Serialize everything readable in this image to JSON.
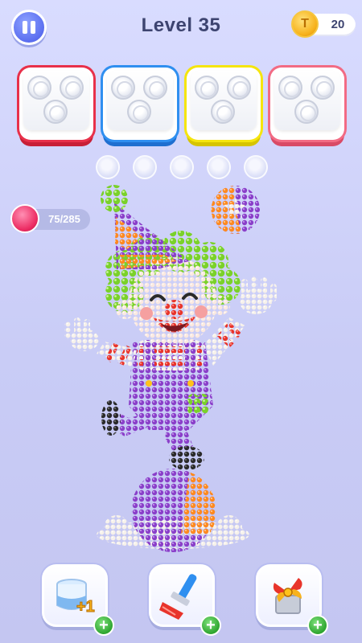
{
  "header": {
    "level_label": "Level 35",
    "coins": "20"
  },
  "progress": {
    "label": "75/285",
    "collected": 75,
    "total": 285
  },
  "boxes": [
    {
      "color": "#e8304a",
      "jars": 3
    },
    {
      "color": "#2f8ff0",
      "jars": 3
    },
    {
      "color": "#f5e50e",
      "jars": 3
    },
    {
      "color": "#f26b84",
      "jars": 3
    }
  ],
  "slots_count": 5,
  "tools": [
    {
      "name": "extra-jar",
      "badge": "+1"
    },
    {
      "name": "brush"
    },
    {
      "name": "fan"
    }
  ],
  "colors": {
    "purple": "#8a3fc9",
    "orange": "#ff8a1f",
    "green": "#7ad12a",
    "red": "#e8342b",
    "white": "#f4efe7"
  }
}
